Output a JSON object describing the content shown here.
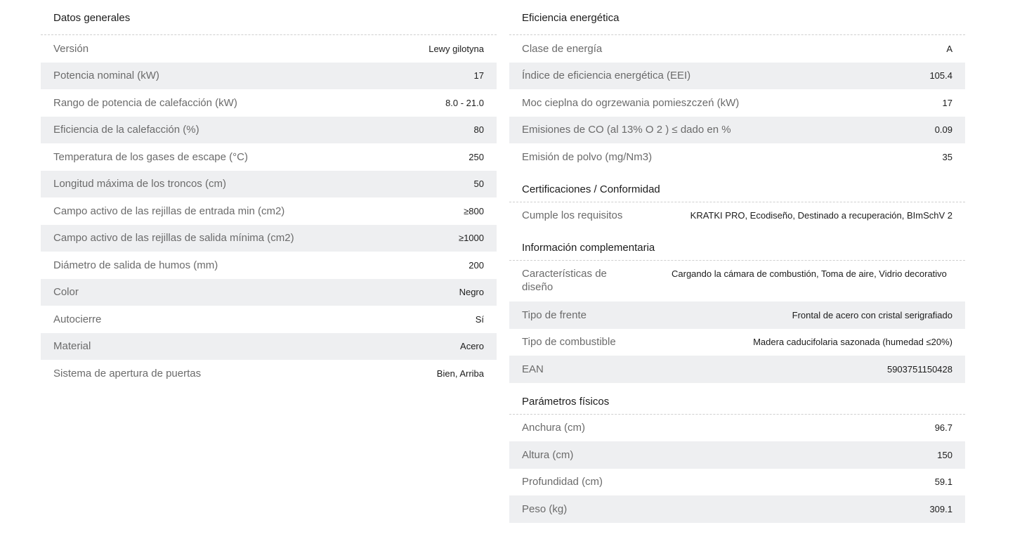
{
  "left": {
    "title": "Datos generales",
    "rows": [
      {
        "label": "Versión",
        "value": "Lewy gilotyna"
      },
      {
        "label": "Potencia nominal (kW)",
        "value": "17"
      },
      {
        "label": "Rango de potencia de calefacción (kW)",
        "value": "8.0 - 21.0"
      },
      {
        "label": "Eficiencia de la calefacción (%)",
        "value": "80"
      },
      {
        "label": "Temperatura de los gases de escape (°C)",
        "value": "250"
      },
      {
        "label": "Longitud máxima de los troncos (cm)",
        "value": "50"
      },
      {
        "label": "Campo activo de las rejillas de entrada min (cm2)",
        "value": "≥800"
      },
      {
        "label": "Campo activo de las rejillas de salida mínima (cm2)",
        "value": "≥1000"
      },
      {
        "label": "Diámetro de salida de humos (mm)",
        "value": "200"
      },
      {
        "label": "Color",
        "value": "Negro"
      },
      {
        "label": "Autocierre",
        "value": "Sí"
      },
      {
        "label": "Material",
        "value": "Acero"
      },
      {
        "label": "Sistema de apertura de puertas",
        "value": "Bien, Arriba"
      }
    ]
  },
  "energy": {
    "title": "Eficiencia energética",
    "rows": [
      {
        "label": "Clase de energía",
        "value": "A"
      },
      {
        "label": "Índice de eficiencia energética (EEI)",
        "value": "105.4"
      },
      {
        "label": "Moc cieplna do ogrzewania pomieszczeń (kW)",
        "value": "17"
      },
      {
        "label": "Emisiones de CO (al 13% O 2 ) ≤ dado en %",
        "value": "0.09"
      },
      {
        "label": "Emisión de polvo (mg/Nm3)",
        "value": "35"
      }
    ]
  },
  "cert": {
    "title": "Certificaciones / Conformidad",
    "rows": [
      {
        "label": "Cumple los requisitos",
        "value": "KRATKI PRO, Ecodiseño, Destinado a recuperación, BImSchV 2"
      }
    ]
  },
  "extra": {
    "title": "Información complementaria",
    "rows": [
      {
        "label": "Características de diseño",
        "value": "Cargando la cámara de combustión, Toma de aire, Vidrio decorativo"
      },
      {
        "label": "Tipo de frente",
        "value": "Frontal de acero con cristal serigrafiado"
      },
      {
        "label": "Tipo de combustible",
        "value": "Madera caducifolaria sazonada (humedad ≤20%)"
      },
      {
        "label": "EAN",
        "value": "5903751150428"
      }
    ]
  },
  "physical": {
    "title": "Parámetros físicos",
    "rows": [
      {
        "label": "Anchura (cm)",
        "value": "96.7"
      },
      {
        "label": "Altura (cm)",
        "value": "150"
      },
      {
        "label": "Profundidad (cm)",
        "value": "59.1"
      },
      {
        "label": "Peso (kg)",
        "value": "309.1"
      }
    ]
  }
}
